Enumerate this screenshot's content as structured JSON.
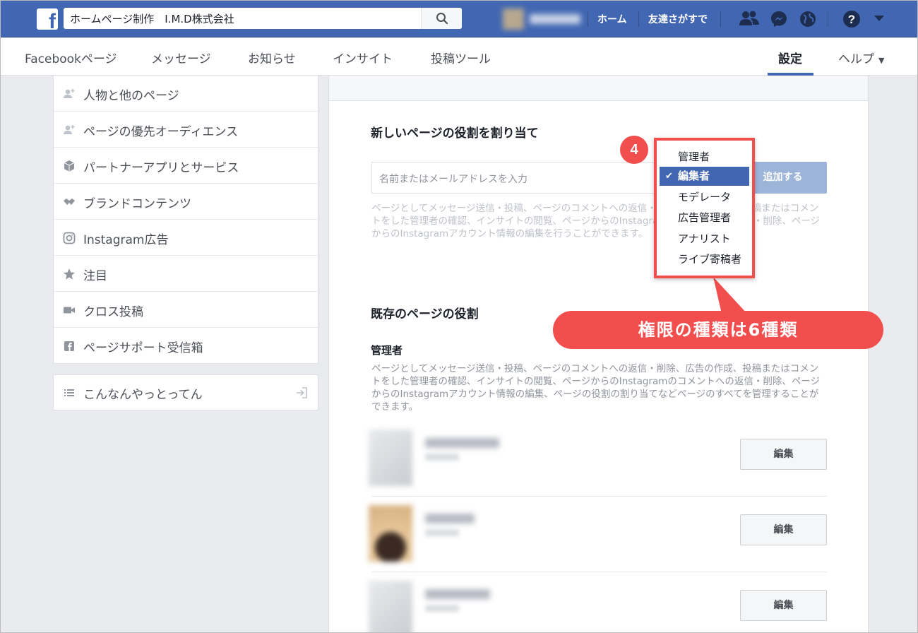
{
  "search": {
    "value": "ホームページ制作　I.M.D株式会社"
  },
  "topnav": {
    "home": "ホーム",
    "find_friends": "友達さがすで"
  },
  "pagenav": {
    "items": [
      "Facebookページ",
      "メッセージ",
      "お知らせ",
      "インサイト",
      "投稿ツール"
    ],
    "settings": "設定",
    "help": "ヘルプ"
  },
  "sidebar": {
    "items": [
      {
        "label": "人物と他のページ",
        "icon": "person-plus-icon"
      },
      {
        "label": "ページの優先オーディエンス",
        "icon": "person-plus-icon"
      },
      {
        "label": "パートナーアプリとサービス",
        "icon": "cube-icon"
      },
      {
        "label": "ブランドコンテンツ",
        "icon": "handshake-icon"
      },
      {
        "label": "Instagram広告",
        "icon": "instagram-icon"
      },
      {
        "label": "注目",
        "icon": "star-icon"
      },
      {
        "label": "クロス投稿",
        "icon": "video-camera-icon"
      },
      {
        "label": "ページサポート受信箱",
        "icon": "facebook-square-icon"
      }
    ],
    "activity_log": "こんなんやっとってん"
  },
  "assign": {
    "heading": "新しいページの役割を割り当て",
    "placeholder": "名前またはメールアドレスを入力",
    "add_button": "追加する",
    "description": "ページとしてメッセージ送信・投稿、ページのコメントへの返信・削除、広告の作成、投稿またはコメントをした管理者の確認、インサイトの閲覧、ページからのInstagramのコメントへの返信・削除、ページからのInstagramアカウント情報の編集を行うことができます。"
  },
  "role_dropdown": {
    "options": [
      "管理者",
      "編集者",
      "モデレータ",
      "広告管理者",
      "アナリスト",
      "ライブ寄稿者"
    ],
    "selected": "編集者"
  },
  "existing": {
    "heading": "既存のページの役割",
    "admin_heading": "管理者",
    "admin_description": "ページとしてメッセージ送信・投稿、ページのコメントへの返信・削除、広告の作成、投稿またはコメントをした管理者の確認、インサイトの閲覧、ページからのInstagramのコメントへの返信・削除、ページからのInstagramアカウント情報の編集、ページの役割の割り当てなどページのすべてを管理することができます。",
    "edit_label": "編集"
  },
  "annotation": {
    "step": "4",
    "callout": "権限の種類は6種類"
  },
  "colors": {
    "brand": "#4267b2",
    "annotation_red": "#f24e4e"
  }
}
